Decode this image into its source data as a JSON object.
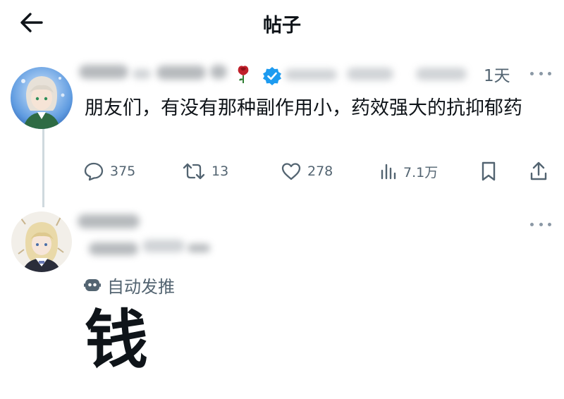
{
  "header": {
    "title": "帖子",
    "back_icon": "arrow-left-icon"
  },
  "post": {
    "time": "1天",
    "text": "朋友们，有没有那种副作用小，药效强大的抗抑郁药",
    "badge_icon": "verified-badge-icon",
    "emoji_icon": "rose-icon",
    "actions": {
      "reply_count": "375",
      "retweet_count": "13",
      "like_count": "278",
      "view_count": "7.1万"
    }
  },
  "reply": {
    "automated_label": "自动发推",
    "text": "钱"
  },
  "colors": {
    "text": "#0f1419",
    "secondary": "#536471",
    "verified": "#1d9bf0",
    "rose": "#c0202a",
    "thread_line": "#cfd9de"
  }
}
